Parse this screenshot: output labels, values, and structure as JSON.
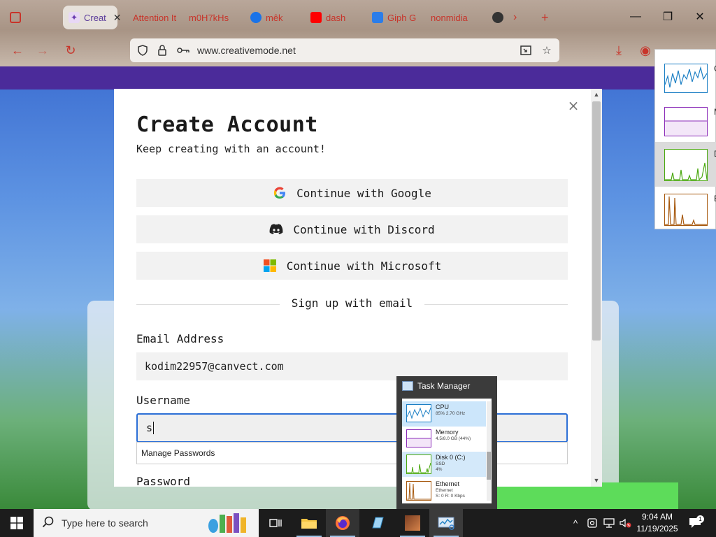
{
  "browser": {
    "tabs": [
      {
        "label": "Creat",
        "active": true
      },
      {
        "label": "Attention It"
      },
      {
        "label": "m0H7kHs"
      },
      {
        "label": "mêk"
      },
      {
        "label": "dash"
      },
      {
        "label": "Giph G"
      },
      {
        "label": "nonmidia"
      }
    ],
    "new_tab": "+",
    "url": "www.creativemode.net"
  },
  "modal": {
    "title": "Create Account",
    "subtitle": "Keep creating with an account!",
    "google_label": "Continue with Google",
    "discord_label": "Continue with Discord",
    "microsoft_label": "Continue with Microsoft",
    "divider_text": "Sign up with email",
    "email_label": "Email Address",
    "email_value": "kodim22957@canvect.com",
    "username_label": "Username",
    "username_value": "s",
    "autocomplete_item": "Manage Passwords",
    "password_label": "Password",
    "close": "×"
  },
  "perf_panel": {
    "items": [
      {
        "label": "C",
        "color": "#1c7fc4"
      },
      {
        "label": "M",
        "color": "#8b2cb8"
      },
      {
        "label": "D",
        "color": "#4aa80f"
      },
      {
        "label": "E",
        "color": "#a7590e"
      }
    ]
  },
  "task_manager": {
    "title": "Task Manager",
    "rows": [
      {
        "name": "CPU",
        "stat": "85% 2.70 GHz"
      },
      {
        "name": "Memory",
        "stat": "4.5/8.0 GB (44%)"
      },
      {
        "name": "Disk 0 (C:)",
        "stat": "SSD",
        "stat2": "4%"
      },
      {
        "name": "Ethernet",
        "stat": "Ethernet",
        "stat2": "S: 0 R: 0 Kbps"
      }
    ]
  },
  "taskbar": {
    "search_placeholder": "Type here to search",
    "time": "9:04 AM",
    "date": "11/19/2025",
    "notification_count": "1"
  }
}
